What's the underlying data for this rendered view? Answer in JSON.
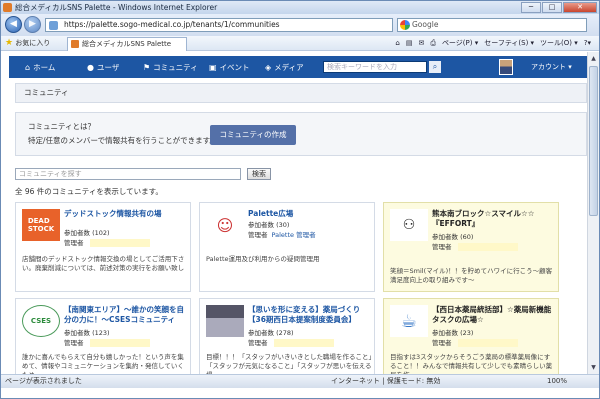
{
  "window": {
    "title": "総合メディカルSNS Palette - Windows Internet Explorer",
    "min": "─",
    "max": "□",
    "close": "✕"
  },
  "addressbar": {
    "url": "https://palette.sogo-medical.co.jp/tenants/1/communities",
    "search_engine": "Google"
  },
  "commandbar": {
    "favorites": "お気に入り",
    "tab_title": "総合メディカルSNS Palette",
    "page_menu": "ページ(P) ▾",
    "safety_menu": "セーフティ(S) ▾",
    "tools_menu": "ツール(O) ▾",
    "help_menu": "?▾"
  },
  "site_nav": {
    "home": "ホーム",
    "users": "ユーザ",
    "community": "コミュニティ",
    "events": "イベント",
    "media": "メディア",
    "search_placeholder": "検索キーワードを入力",
    "account": "アカウント ▾"
  },
  "breadcrumb": "コミュニティ",
  "about": {
    "question": "コミュニティとは？",
    "description": "特定/任意のメンバーで情報共有を行うことができます。",
    "create_button": "コミュニティの作成"
  },
  "search": {
    "placeholder": "コミュニティを探す",
    "button": "検索"
  },
  "count_text": "全 96 件のコミュニティを表示しています。",
  "communities": [
    {
      "name": "デッドストック情報共有の場",
      "members": "参加者数 (102)",
      "manager_label": "管理者",
      "manager": "",
      "desc": "店舗間のデッドストック情報交換の場としてご活用下さい。廃棄削減については、前述対策の実行をお願い致し"
    },
    {
      "name": "Palette広場",
      "members": "参加者数 (30)",
      "manager_label": "管理者",
      "manager": "Palette 管理者",
      "desc": "Palette運用及び利用からの疑問管理用"
    },
    {
      "name": "熊本南ブロック☆スマイル☆☆『EFFORT』",
      "members": "参加者数 (60)",
      "manager_label": "管理者",
      "manager": "",
      "desc": "笑顔＝Smil(マイル)！！を貯めてハワイに行こう〜顧客満足度向上の取り組みです〜"
    },
    {
      "name": "【南関東エリア】〜誰かの笑顔を自分の力に！〜CSESコミュニティ",
      "members": "参加者数 (123)",
      "manager_label": "管理者",
      "manager": "",
      "desc": "誰かに喜んでもらえて自分も嬉しかった！という声を集めて、情報やコミュニケーションを集約・発信していくため"
    },
    {
      "name": "【思いを形に変える】薬局づくり【36期西日本提案制度委員会】",
      "members": "参加者数 (278)",
      "manager_label": "管理者",
      "manager": "",
      "desc": "目標！！！「スタッフがいきいきとした職場を作ること」「スタッフが元気になること」「スタッフが思いを伝える場"
    },
    {
      "name": "【西日本薬局統括部】☆薬局新機能タスクの広場☆",
      "members": "参加者数 (23)",
      "manager_label": "管理者",
      "manager": "",
      "desc": "目指すは3スタックからそうごう薬局の標準薬局像にすること！！みんなで情報共有して少しでも素晴らしい薬局を作"
    }
  ],
  "statusbar": {
    "status": "ページが表示されました",
    "zone": "インターネット | 保護モード: 無効",
    "zoom": "100%"
  },
  "colors": {
    "nav_blue": "#1d56a3",
    "create_button": "#5470a8",
    "highlight_card": "#fdfbe0"
  }
}
